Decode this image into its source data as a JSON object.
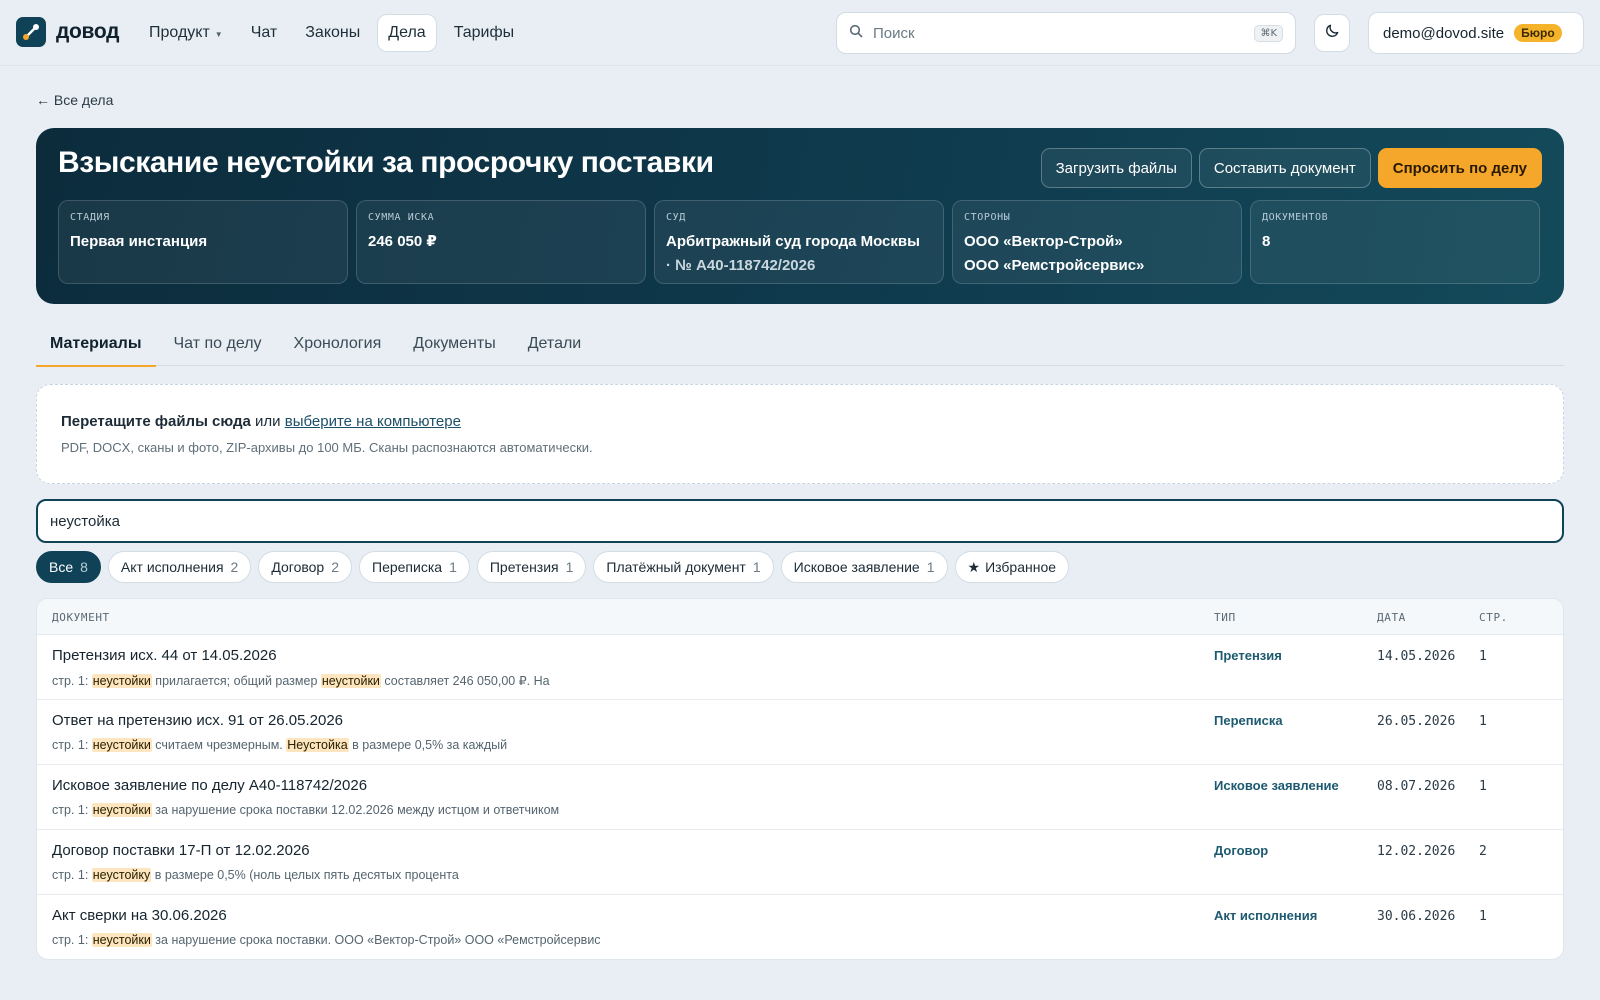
{
  "brand": {
    "name": "довод",
    "logo_icon": "link-chart-icon",
    "accent": "#f4a72b",
    "dark": "#0f4257"
  },
  "nav": {
    "items": [
      {
        "label": "Продукт",
        "has_caret": true
      },
      {
        "label": "Чат"
      },
      {
        "label": "Законы"
      },
      {
        "label": "Дела",
        "active": true
      },
      {
        "label": "Тарифы"
      }
    ]
  },
  "search": {
    "placeholder": "Поиск",
    "shortcut": "⌘K",
    "icon": "search-icon"
  },
  "theme_toggle": {
    "icon": "moon-icon"
  },
  "account": {
    "email": "demo@dovod.site",
    "plan": "Бюро"
  },
  "back_link": "← Все дела",
  "case": {
    "title": "Взыскание неустойки за просрочку поставки",
    "actions": {
      "upload": "Загрузить файлы",
      "compose": "Составить документ",
      "ask": "Спросить по делу"
    },
    "stats": [
      {
        "label": "Стадия",
        "value": "Первая инстанция",
        "sub": ""
      },
      {
        "label": "Сумма иска",
        "value": "246 050 ₽",
        "sub": ""
      },
      {
        "label": "Суд",
        "value": "Арбитражный суд города Москвы",
        "sub": "· № А40-118742/2026"
      },
      {
        "label": "Стороны",
        "value": "ООО «Вектор-Строй»",
        "sub": "ООО «Ремстройсервис»"
      },
      {
        "label": "Документов",
        "value": "8",
        "sub": ""
      }
    ]
  },
  "tabs": [
    {
      "label": "Материалы",
      "active": true
    },
    {
      "label": "Чат по делу"
    },
    {
      "label": "Хронология"
    },
    {
      "label": "Документы"
    },
    {
      "label": "Детали"
    }
  ],
  "dropzone": {
    "strong": "Перетащите файлы сюда",
    "or": " или ",
    "link": "выберите на компьютере",
    "hint": "PDF, DOCX, сканы и фото, ZIP-архивы до 100 МБ. Сканы распознаются автоматически."
  },
  "filter": {
    "value": "неустойка"
  },
  "chips": [
    {
      "label": "Все",
      "count": "8",
      "active": true
    },
    {
      "label": "Акт исполнения",
      "count": "2"
    },
    {
      "label": "Договор",
      "count": "2"
    },
    {
      "label": "Переписка",
      "count": "1"
    },
    {
      "label": "Претензия",
      "count": "1"
    },
    {
      "label": "Платёжный документ",
      "count": "1"
    },
    {
      "label": "Исковое заявление",
      "count": "1"
    },
    {
      "label": "Избранное",
      "count": "",
      "star": true
    }
  ],
  "table": {
    "columns": {
      "document": "Документ",
      "type": "Тип",
      "date": "Дата",
      "pages": "Стр."
    },
    "rows": [
      {
        "title": "Претензия исх. 44 от 14.05.2026",
        "snippet": [
          {
            "t": "стр. 1: "
          },
          {
            "t": "неустойки",
            "hl": true
          },
          {
            "t": " прилагается; общий размер "
          },
          {
            "t": "неустойки",
            "hl": true
          },
          {
            "t": " составляет 246 050,00 ₽. На"
          }
        ],
        "type": "Претензия",
        "date": "14.05.2026",
        "pages": "1"
      },
      {
        "title": "Ответ на претензию исх. 91 от 26.05.2026",
        "snippet": [
          {
            "t": "стр. 1: "
          },
          {
            "t": "неустойки",
            "hl": true
          },
          {
            "t": " считаем чрезмерным. "
          },
          {
            "t": "Неустойка",
            "hl": true
          },
          {
            "t": " в размере 0,5% за каждый"
          }
        ],
        "type": "Переписка",
        "date": "26.05.2026",
        "pages": "1"
      },
      {
        "title": "Исковое заявление по делу А40-118742/2026",
        "snippet": [
          {
            "t": "стр. 1: "
          },
          {
            "t": "неустойки",
            "hl": true
          },
          {
            "t": " за нарушение срока поставки 12.02.2026 между истцом и ответчиком"
          }
        ],
        "type": "Исковое заявление",
        "date": "08.07.2026",
        "pages": "1"
      },
      {
        "title": "Договор поставки 17-П от 12.02.2026",
        "snippet": [
          {
            "t": "стр. 1: "
          },
          {
            "t": "неустойку",
            "hl": true
          },
          {
            "t": " в размере 0,5% (ноль целых пять десятых процента"
          }
        ],
        "type": "Договор",
        "date": "12.02.2026",
        "pages": "2"
      },
      {
        "title": "Акт сверки на 30.06.2026",
        "snippet": [
          {
            "t": "стр. 1: "
          },
          {
            "t": "неустойки",
            "hl": true
          },
          {
            "t": " за нарушение срока поставки. ООО «Вектор-Строй» ООО «Ремстройсервис"
          }
        ],
        "type": "Акт исполнения",
        "date": "30.06.2026",
        "pages": "1"
      }
    ]
  }
}
